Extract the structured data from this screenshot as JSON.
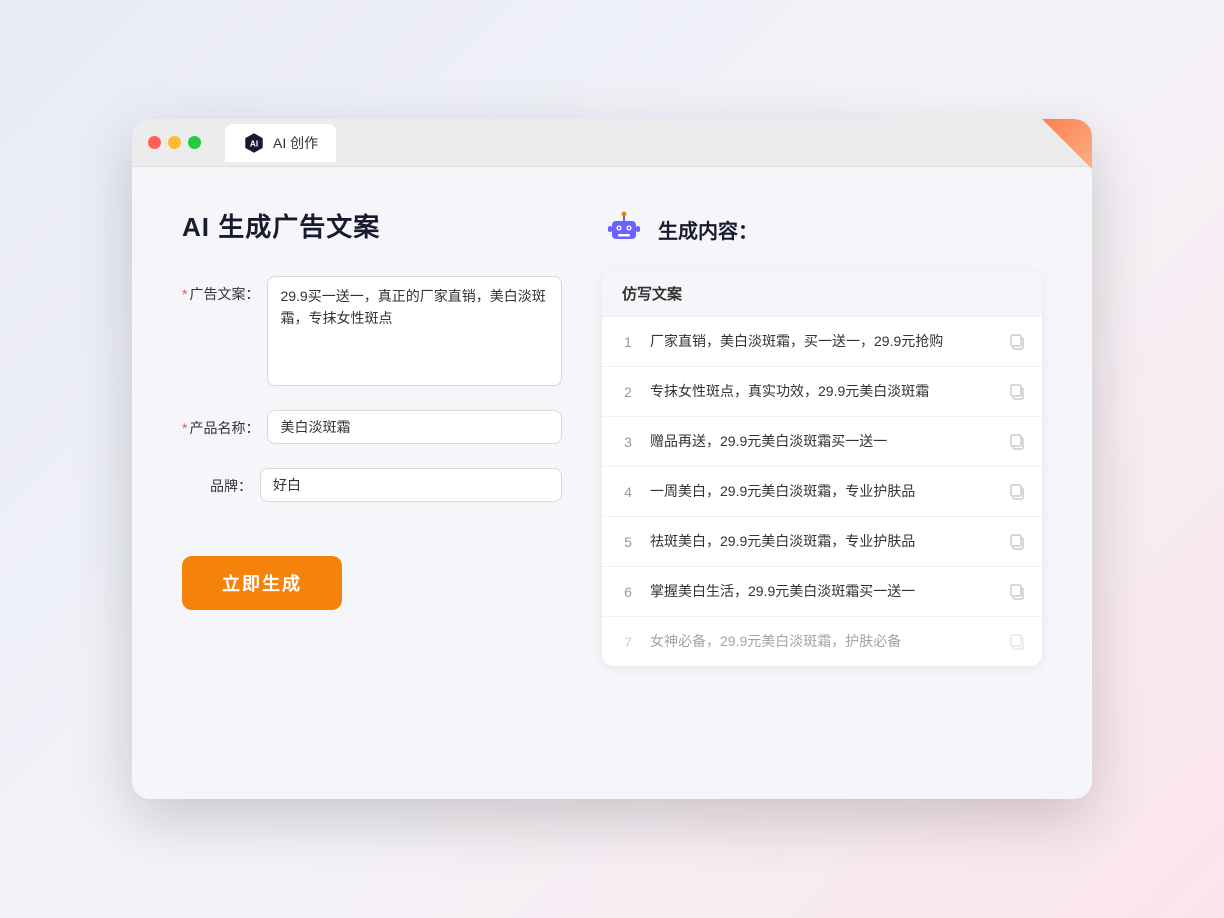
{
  "window": {
    "tab_label": "AI 创作"
  },
  "left_panel": {
    "title": "AI 生成广告文案",
    "fields": [
      {
        "id": "ad_copy",
        "label": "广告文案：",
        "required": true,
        "type": "textarea",
        "value": "29.9买一送一，真正的厂家直销，美白淡斑霜，专抹女性斑点"
      },
      {
        "id": "product_name",
        "label": "产品名称：",
        "required": true,
        "type": "input",
        "value": "美白淡斑霜"
      },
      {
        "id": "brand",
        "label": "品牌：",
        "required": false,
        "type": "input",
        "value": "好白"
      }
    ],
    "generate_button": "立即生成"
  },
  "right_panel": {
    "title": "生成内容：",
    "table_header": "仿写文案",
    "results": [
      {
        "num": "1",
        "text": "厂家直销，美白淡斑霜，买一送一，29.9元抢购",
        "faded": false
      },
      {
        "num": "2",
        "text": "专抹女性斑点，真实功效，29.9元美白淡斑霜",
        "faded": false
      },
      {
        "num": "3",
        "text": "赠品再送，29.9元美白淡斑霜买一送一",
        "faded": false
      },
      {
        "num": "4",
        "text": "一周美白，29.9元美白淡斑霜，专业护肤品",
        "faded": false
      },
      {
        "num": "5",
        "text": "祛斑美白，29.9元美白淡斑霜，专业护肤品",
        "faded": false
      },
      {
        "num": "6",
        "text": "掌握美白生活，29.9元美白淡斑霜买一送一",
        "faded": false
      },
      {
        "num": "7",
        "text": "女神必备，29.9元美白淡斑霜，护肤必备",
        "faded": true
      }
    ]
  }
}
